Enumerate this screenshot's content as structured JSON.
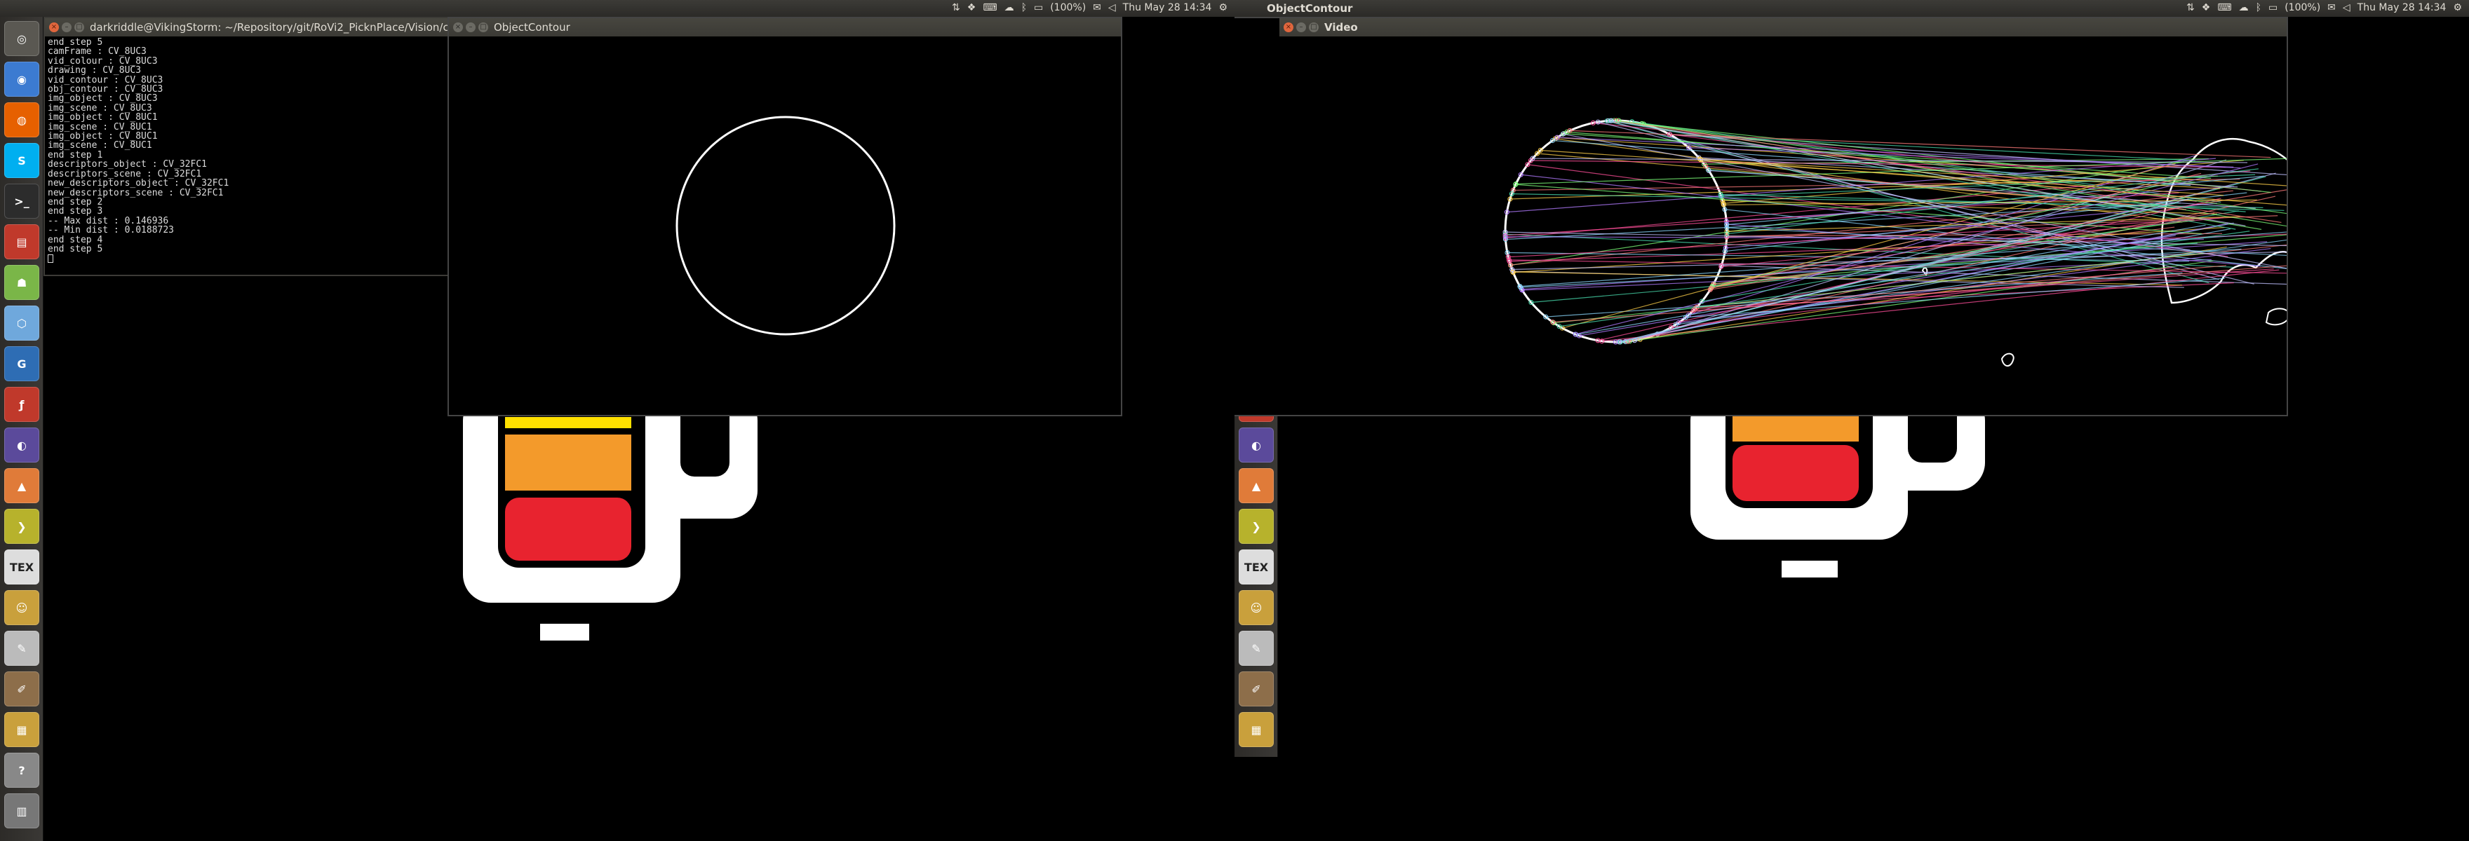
{
  "left": {
    "panel_title": "",
    "indicators": {
      "battery": "(100%)",
      "datetime": "Thu May 28  14:34"
    },
    "terminal": {
      "title": "darkriddle@VikingStorm: ~/Repository/git/RoVi2_PicknPlace/Vision/c",
      "lines": [
        "end step 5",
        "camFrame : CV_8UC3",
        "vid_colour : CV_8UC3",
        "drawing : CV_8UC3",
        "vid_contour : CV_8UC3",
        "obj_contour : CV_8UC3",
        "img_object : CV_8UC3",
        "img_scene : CV_8UC3",
        "img_object : CV_8UC1",
        "img_scene : CV_8UC1",
        "img_object : CV_8UC1",
        "img_scene : CV_8UC1",
        "end step 1",
        "descriptors_object : CV_32FC1",
        "descriptors_scene : CV_32FC1",
        "new_descriptors_object : CV_32FC1",
        "new_descriptors_scene : CV_32FC1",
        "end step 2",
        "end step 3",
        "-- Max dist : 0.146936",
        "-- Min dist : 0.0188723",
        "end step 4",
        "end step 5"
      ]
    },
    "object_contour_window": {
      "title": "ObjectContour"
    }
  },
  "right": {
    "panel_title": "ObjectContour",
    "indicators": {
      "battery": "(100%)",
      "datetime": "Thu May 28  14:34"
    },
    "video_window": {
      "title": "Video"
    }
  },
  "launcher": {
    "items": [
      {
        "name": "dash-home",
        "icon": "ubuntu-logo-icon",
        "color": "#5a5852"
      },
      {
        "name": "chrome",
        "icon": "chrome-icon",
        "color": "#3c7bd1"
      },
      {
        "name": "firefox",
        "icon": "firefox-icon",
        "color": "#e66000"
      },
      {
        "name": "skype",
        "icon": "skype-icon",
        "color": "#00aff0"
      },
      {
        "name": "terminal",
        "icon": "terminal-icon",
        "color": "#2c2c2c"
      },
      {
        "name": "files",
        "icon": "files-icon",
        "color": "#c0392b"
      },
      {
        "name": "android",
        "icon": "android-icon",
        "color": "#7ab648"
      },
      {
        "name": "virtualbox",
        "icon": "box-icon",
        "color": "#6fa8dc"
      },
      {
        "name": "geany",
        "icon": "g-icon",
        "color": "#2e6db4"
      },
      {
        "name": "flash",
        "icon": "flash-icon",
        "color": "#c0392b"
      },
      {
        "name": "eclipse",
        "icon": "eclipse-icon",
        "color": "#5b4a9b"
      },
      {
        "name": "matlab",
        "icon": "matlab-icon",
        "color": "#e07b39"
      },
      {
        "name": "arrow-app",
        "icon": "chevron-right-icon",
        "color": "#b7b22c"
      },
      {
        "name": "texmaker",
        "icon": "tex-icon",
        "color": "#dddddd"
      },
      {
        "name": "pidgin",
        "icon": "face-icon",
        "color": "#c9a03c"
      },
      {
        "name": "text-editor",
        "icon": "pencil-icon",
        "color": "#bbbbbb"
      },
      {
        "name": "gimp",
        "icon": "gimp-icon",
        "color": "#8d6e4a"
      },
      {
        "name": "document-viewer",
        "icon": "document-icon",
        "color": "#c9a03c"
      },
      {
        "name": "help",
        "icon": "question-icon",
        "color": "#888888"
      },
      {
        "name": "trash",
        "icon": "trash-icon",
        "color": "#777777"
      }
    ],
    "tex_label": "TEX",
    "g_label": "G",
    "help_label": "?"
  },
  "colors": {
    "mug_yellow": "#ffe000",
    "mug_orange": "#f39a2b",
    "mug_red": "#e8232f",
    "panel_bg": "#3c3b37",
    "close_button": "#e0663d"
  }
}
